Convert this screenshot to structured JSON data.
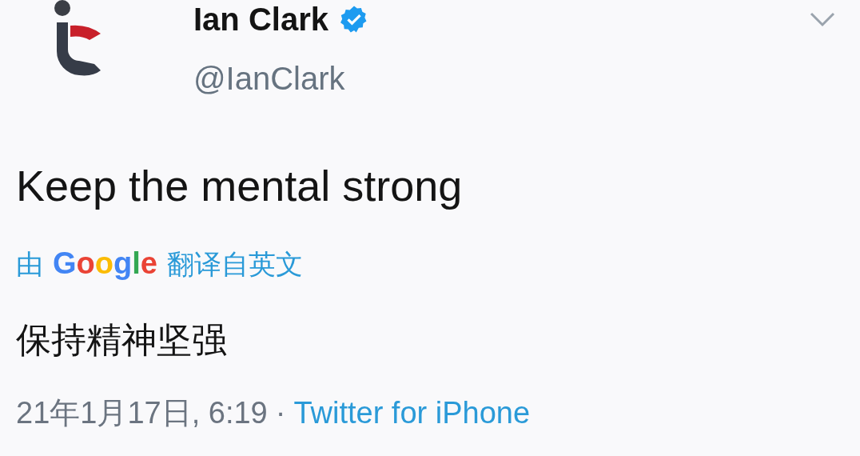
{
  "author": {
    "name": "Ian Clark",
    "verified": true,
    "handle": "@IanClark"
  },
  "text": "Keep the mental strong",
  "translation": {
    "prefix": "由",
    "service": "Google",
    "suffix": "翻译自英文"
  },
  "translated_text": "保持精神坚强",
  "meta": {
    "timestamp": "21年1月17日, 6:19",
    "separator": "·",
    "source": "Twitter for iPhone"
  }
}
